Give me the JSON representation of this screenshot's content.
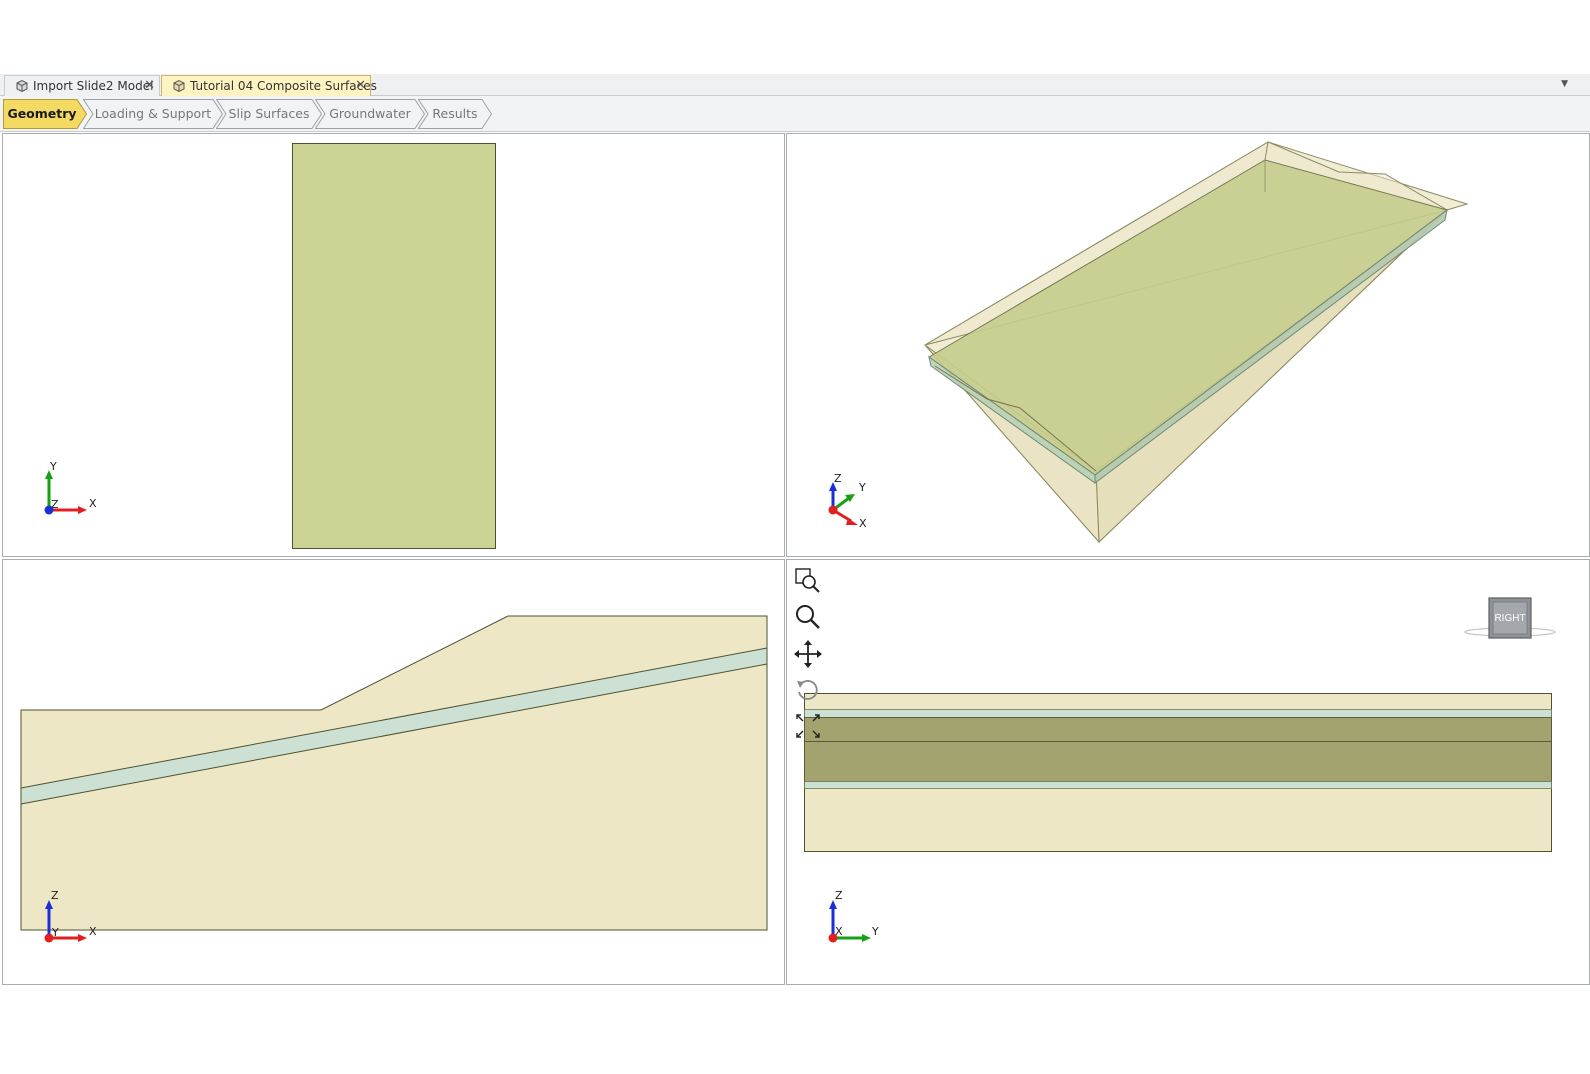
{
  "document_tabs": [
    {
      "label": "Import Slide2 Model",
      "active": false
    },
    {
      "label": "Tutorial 04 Composite Surfaces",
      "active": true
    }
  ],
  "workflow_steps": [
    {
      "label": "Geometry",
      "active": true
    },
    {
      "label": "Loading & Support",
      "active": false
    },
    {
      "label": "Slip Surfaces",
      "active": false
    },
    {
      "label": "Groundwater",
      "active": false
    },
    {
      "label": "Results",
      "active": false
    }
  ],
  "viewports": {
    "top": {
      "axes": [
        "Y",
        "Z",
        "X"
      ]
    },
    "perspective": {
      "axes": [
        "Z",
        "Y",
        "X"
      ]
    },
    "front": {
      "axes": [
        "Z",
        "Y",
        "X"
      ]
    },
    "right": {
      "axes": [
        "Z",
        "X",
        "Y"
      ],
      "view_cube_label": "RIGHT",
      "tools": [
        "zoom-extents-icon",
        "zoom-icon",
        "pan-icon",
        "rotate-icon",
        "expand-view-icon"
      ]
    }
  },
  "colors": {
    "soil_light": "#ede7c6",
    "soil_top_view": "#cdd295",
    "weak_layer": "#cde0d4",
    "accent_tab": "#f4da62",
    "axis_x": "#e02020",
    "axis_y": "#16a016",
    "axis_z": "#1a2fd6"
  }
}
